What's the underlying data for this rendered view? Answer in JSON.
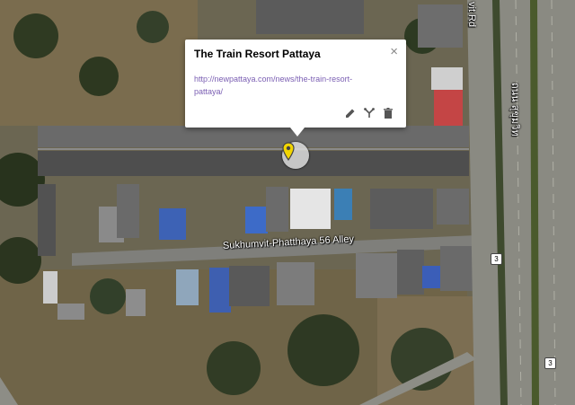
{
  "popup": {
    "title": "The Train Resort Pattaya",
    "link": "http://newpattaya.com/news/the-train-resort-pattaya/",
    "close_glyph": "×",
    "tools": [
      "edit-icon",
      "style-icon",
      "delete-icon"
    ]
  },
  "map": {
    "street_labels": {
      "alley": "Sukhumvit-Phatthaya 56 Alley",
      "road_thai": "ถนน สุขุมวิท",
      "road_en": "vit Rd"
    },
    "route_shields": [
      "3",
      "3"
    ],
    "pin_color": "#f2d500"
  }
}
